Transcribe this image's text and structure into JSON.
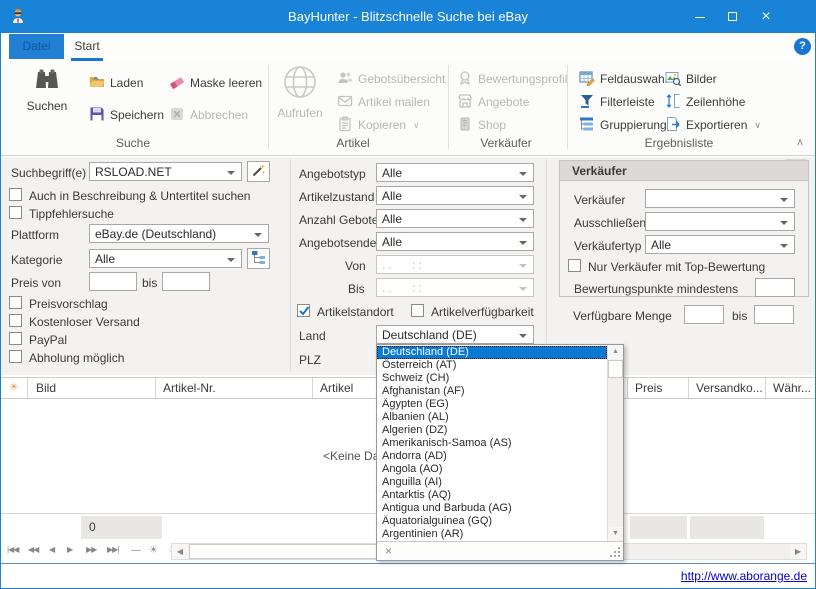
{
  "window": {
    "title": "BayHunter - Blitzschnelle Suche bei eBay"
  },
  "icons": {
    "help": "?",
    "close": "×",
    "menu_chevron": "∨",
    "ribbon_collapse": "∧",
    "row_indicator": "✳",
    "clear_filter": "×",
    "scroll_left": "◀",
    "scroll_right": "▶",
    "scroll_up": "▲",
    "scroll_down": "▼",
    "nav": [
      "|◀◀",
      "◀◀",
      "◀",
      "▶",
      "▶▶",
      "▶▶|",
      "—",
      "☀",
      "☀",
      "▼"
    ]
  },
  "ribbon": {
    "tabs": {
      "file": "Datei",
      "start": "Start"
    },
    "groups": {
      "suche": {
        "caption": "Suche",
        "suchen": "Suchen",
        "laden": "Laden",
        "speichern": "Speichern",
        "maske_leeren": "Maske leeren",
        "abbrechen": "Abbrechen"
      },
      "artikel": {
        "caption": "Artikel",
        "aufrufen": "Aufrufen",
        "gebotsuebersicht": "Gebotsübersicht",
        "artikel_mailen": "Artikel mailen",
        "kopieren": "Kopieren"
      },
      "verkaeufer": {
        "caption": "Verkäufer",
        "bewertungsprofil": "Bewertungsprofil",
        "angebote": "Angebote",
        "shop": "Shop"
      },
      "ergebnisliste": {
        "caption": "Ergebnisliste",
        "feldauswahl": "Feldauswahl",
        "filterleiste": "Filterleiste",
        "gruppierung": "Gruppierung",
        "bilder": "Bilder",
        "zeilenhoehe": "Zeilenhöhe",
        "exportieren": "Exportieren"
      }
    }
  },
  "form": {
    "suchbegriff_label": "Suchbegriff(e)",
    "suchbegriff_value": "RSLOAD.NET",
    "chk_beschreibung": "Auch in Beschreibung & Untertitel suchen",
    "chk_tippfehler": "Tippfehlersuche",
    "plattform_label": "Plattform",
    "plattform_value": "eBay.de (Deutschland)",
    "kategorie_label": "Kategorie",
    "kategorie_value": "Alle",
    "preis_label": "Preis von",
    "preis_bis": "bis",
    "chk_preisvorschlag": "Preisvorschlag",
    "chk_versand": "Kostenloser Versand",
    "chk_paypal": "PayPal",
    "chk_abholung": "Abholung möglich",
    "angebotstyp_label": "Angebotstyp",
    "angebotstyp_value": "Alle",
    "artikelzustand_label": "Artikelzustand",
    "artikelzustand_value": "Alle",
    "anzahl_gebote_label": "Anzahl Gebote",
    "anzahl_gebote_value": "Alle",
    "angebotsende_label": "Angebotsende",
    "angebotsende_value": "Alle",
    "von_label": "Von",
    "von_value": ". .      : :",
    "bis_label": "Bis",
    "bis_value": ". .      : :",
    "chk_artikelstandort": "Artikelstandort",
    "chk_artikelverfuegbarkeit": "Artikelverfügbarkeit",
    "land_label": "Land",
    "land_value": "Deutschland (DE)",
    "plz_label": "PLZ",
    "seller": {
      "title": "Verkäufer",
      "verkaeufer_label": "Verkäufer",
      "ausschliessen_label": "Ausschließen",
      "verkaeufertyp_label": "Verkäufertyp",
      "verkaeufertyp_value": "Alle",
      "chk_top": "Nur Verkäufer mit Top-Bewertung",
      "punkte_label": "Bewertungspunkte mindestens"
    },
    "menge_label": "Verfügbare Menge",
    "menge_bis": "bis"
  },
  "dropdown": {
    "selected_index": 0,
    "items": [
      "Deutschland (DE)",
      "Österreich (AT)",
      "Schweiz (CH)",
      "Afghanistan (AF)",
      "Ägypten (EG)",
      "Albanien (AL)",
      "Algerien (DZ)",
      "Amerikanisch-Samoa (AS)",
      "Andorra (AD)",
      "Angola (AO)",
      "Anguilla (AI)",
      "Antarktis (AQ)",
      "Antigua und Barbuda (AG)",
      "Äquatorialguinea (GQ)",
      "Argentinien (AR)"
    ]
  },
  "grid": {
    "columns": [
      "Bild",
      "Artikel-Nr.",
      "Artikel",
      "Preis",
      "Versandko...",
      "Währ..."
    ],
    "empty_text": "<Keine Daten anzuzeigen>",
    "summary_count": "0"
  },
  "statusbar": {
    "link": "http://www.aborange.de"
  },
  "colors": {
    "titlebar": "#1883d7",
    "accent": "#1876d2",
    "selection": "#0b79d0",
    "link": "#0202cc"
  }
}
